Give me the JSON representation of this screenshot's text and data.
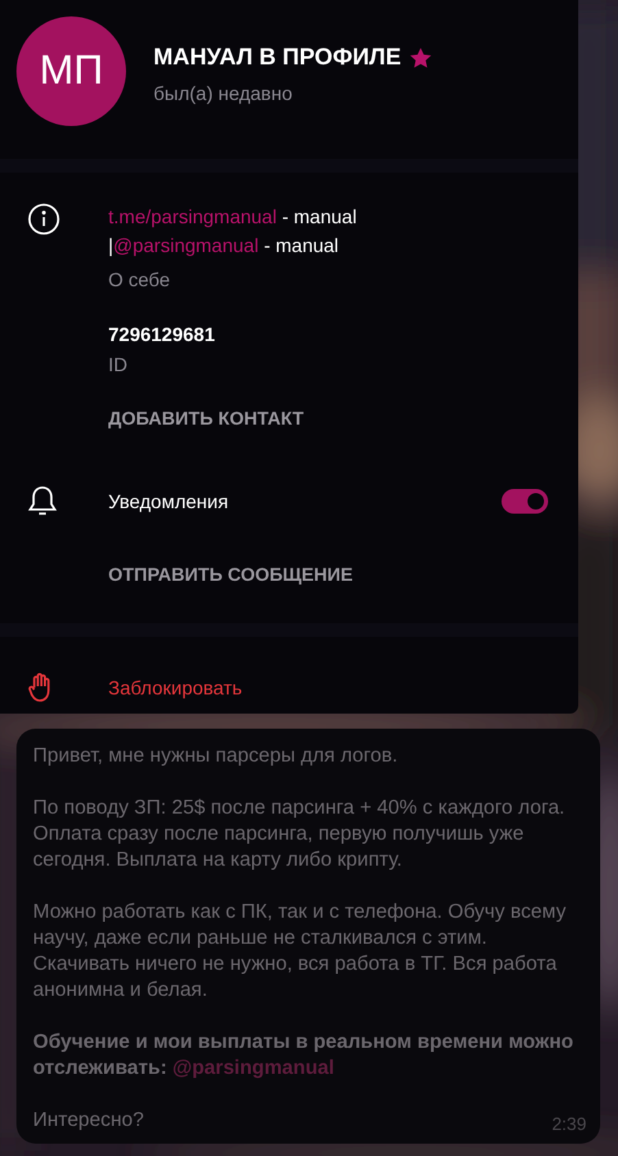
{
  "profile": {
    "initials": "МП",
    "name": "МАНУАЛ В ПРОФИЛЕ",
    "status": "был(а) недавно"
  },
  "bio": {
    "segments": [
      {
        "kind": "link",
        "text": "t.me/parsingmanual"
      },
      {
        "kind": "text",
        "text": " - manual |"
      },
      {
        "kind": "link",
        "text": "@parsingmanual"
      },
      {
        "kind": "text",
        "text": " - manual"
      }
    ],
    "label": "О себе"
  },
  "user_id": {
    "value": "7296129681",
    "label": "ID"
  },
  "add_contact": "ДОБАВИТЬ КОНТАКТ",
  "notifications": {
    "label": "Уведомления",
    "on": true
  },
  "send_message": "ОТПРАВИТЬ СООБЩЕНИЕ",
  "block": "Заблокировать",
  "message": {
    "paragraphs": [
      {
        "kind": "plain",
        "segments": [
          {
            "kind": "text",
            "text": "Привет, мне нужны парсеры для логов."
          }
        ]
      },
      {
        "kind": "plain",
        "segments": [
          {
            "kind": "text",
            "text": "По поводу ЗП: 25$ после парсинга + 40% с каждого лога. Оплата сразу после парсинга, первую получишь уже сегодня. Выплата на карту либо крипту."
          }
        ]
      },
      {
        "kind": "plain",
        "segments": [
          {
            "kind": "text",
            "text": "Можно работать как с ПК, так и с телефона. Обучу всему научу, даже если раньше не сталкивался с этим. Скачивать ничего не нужно, вся работа в ТГ. Вся работа анонимна и белая."
          }
        ]
      },
      {
        "kind": "bold",
        "segments": [
          {
            "kind": "text",
            "text": "Обучение и мои выплаты в реальном времени можно отслеживать: "
          },
          {
            "kind": "link",
            "text": "@parsingmanual"
          }
        ]
      },
      {
        "kind": "plain",
        "segments": [
          {
            "kind": "text",
            "text": "Интересно?"
          }
        ]
      }
    ],
    "time": "2:39"
  }
}
